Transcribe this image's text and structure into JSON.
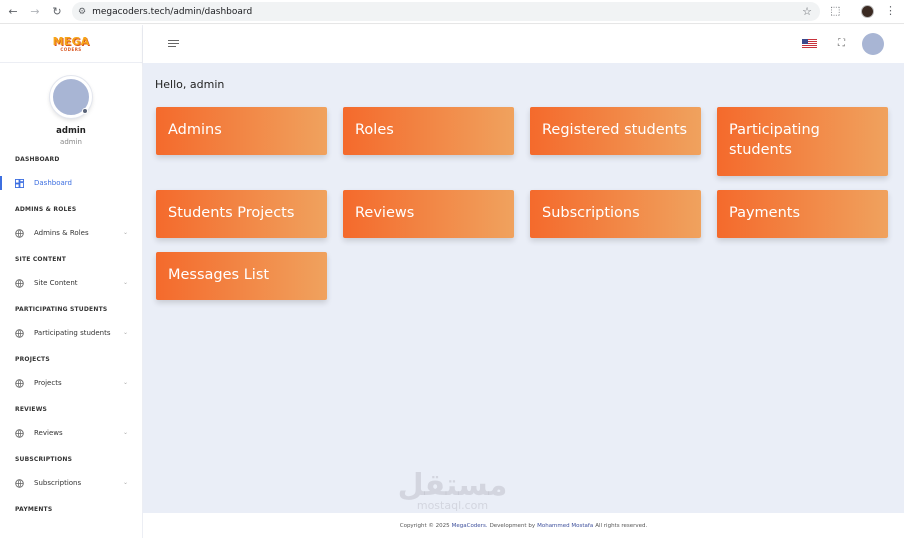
{
  "browser": {
    "url": "megacoders.tech/admin/dashboard",
    "back_icon": "arrow-left-icon",
    "forward_icon": "arrow-right-icon",
    "reload_icon": "reload-icon"
  },
  "brand": {
    "logo_top": "MEGA",
    "logo_bottom": "CODERS",
    "primary": "#f46a2c",
    "secondary": "#f0a25e",
    "accent": "#3d6fe0"
  },
  "user": {
    "name": "admin",
    "role": "admin"
  },
  "sidebar": {
    "sections": [
      {
        "title": "DASHBOARD",
        "item": "Dashboard",
        "active": true,
        "icon": "dashboard-icon"
      },
      {
        "title": "ADMINS & ROLES",
        "item": "Admins & Roles",
        "active": false,
        "icon": "globe-icon"
      },
      {
        "title": "SITE CONTENT",
        "item": "Site Content",
        "active": false,
        "icon": "globe-icon"
      },
      {
        "title": "PARTICIPATING STUDENTS",
        "item": "Participating students",
        "active": false,
        "icon": "globe-icon"
      },
      {
        "title": "PROJECTS",
        "item": "Projects",
        "active": false,
        "icon": "globe-icon"
      },
      {
        "title": "REVIEWS",
        "item": "Reviews",
        "active": false,
        "icon": "globe-icon"
      },
      {
        "title": "SUBSCRIPTIONS",
        "item": "Subscriptions",
        "active": false,
        "icon": "globe-icon"
      },
      {
        "title": "PAYMENTS"
      }
    ]
  },
  "main": {
    "greeting": "Hello, admin",
    "cards": [
      "Admins",
      "Roles",
      "Registered students",
      "Participating students",
      "Students Projects",
      "Reviews",
      "Subscriptions",
      "Payments",
      "Messages List"
    ]
  },
  "footer": {
    "prefix": "Copyright © 2025",
    "brand": "MegaCoders.",
    "middle": "Development by",
    "author": "Mohammed Mostafa",
    "suffix": "All rights reserved."
  },
  "watermark": {
    "line1": "مستقل",
    "line2": "mostaql.com"
  }
}
